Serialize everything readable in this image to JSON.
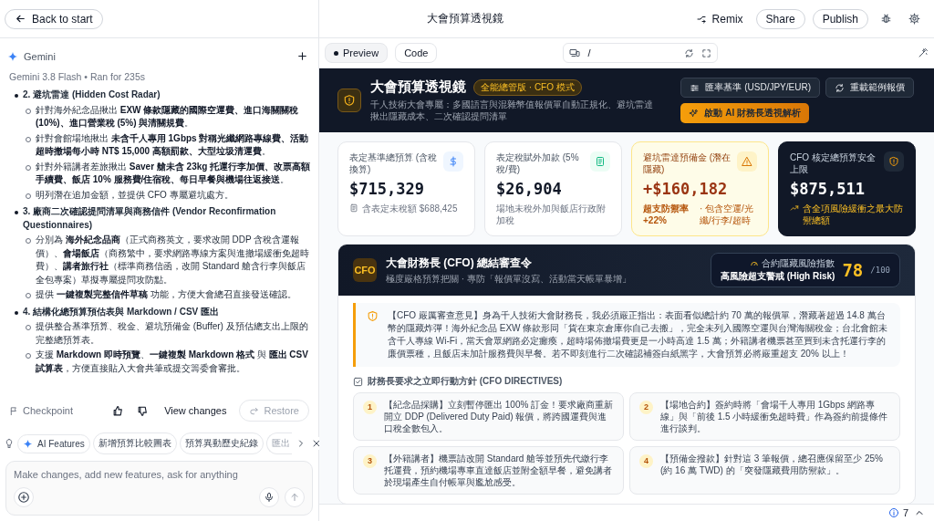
{
  "top_bar": {
    "back_button": "Back to start",
    "title": "大會預算透視鏡",
    "actions": [
      "Remix",
      "Share",
      "Publish"
    ]
  },
  "chat": {
    "assistant": "Gemini",
    "model": "Gemini 3.8 Flash",
    "separator": "•",
    "run_time": "Ran for 235s",
    "items": [
      {
        "text": "2. 避坑雷達 (Hidden Cost Radar)",
        "children": [
          {
            "text": "針對海外紀念品揪出 **EXW 條款隱藏的國際空運費、進口海關關稅 (10%)、進口營業稅 (5%) 與清關規費**。"
          },
          {
            "text": "針對會館場地揪出 **未含千人專用 1Gbps 對稱光纖網路專線費、活動超時撤場每小時 NT$ 15,000 高額罰款、大型垃圾清運費**。"
          },
          {
            "text": "針對外籍講者差旅揪出 **Saver 艙未含 23kg 托運行李加價、改票高額手續費、飯店 10% 服務費/住宿稅、每日早餐與機場往返接送**。"
          },
          {
            "text": "明列潛在追加金額，並提供 CFO 專屬避坑處方。"
          }
        ]
      },
      {
        "text": "3. 廠商二次確認提問清單與商務信件 (Vendor Reconfirmation Questionnaires)",
        "children": [
          {
            "text": "分別為 **海外紀念品商**（正式商務英文，要求改開 DDP 含稅含運報價）、**會場飯店**（商務繁中，要求網路專線方案與進撤場緩衝免超時費）、**講者旅行社**（標準商務信函，改開 Standard 艙含行李與飯店全包專案）草擬專屬提問攻防點。"
          },
          {
            "text": "提供 **一鍵複製完整信件草稿** 功能，方便大會總召直接發送確認。"
          }
        ]
      },
      {
        "text": "4. 結構化總預算預估表與 Markdown / CSV 匯出",
        "children": [
          {
            "text": "提供整合基準預算、稅金、避坑預備金 (Buffer) 及預估總支出上限的完整總預算表。"
          },
          {
            "text": "支援 **Markdown 即時預覽**、**一鍵複製 Markdown 格式** 與 **匯出 CSV 試算表**，方便直接貼入大會共筆或提交籌委會審批。"
          }
        ]
      }
    ],
    "checkpoint": "Checkpoint",
    "view_changes": "View changes",
    "restore": "Restore",
    "chips": [
      "AI Features",
      "新增預算比較圖表",
      "預算異動歷史紀錄",
      "匯出"
    ],
    "input": {
      "placeholder": "Make changes, add new features, ask for anything"
    }
  },
  "preview_toolbar": {
    "tabs": [
      {
        "label": "Preview",
        "selected": true
      },
      {
        "label": "Code",
        "selected": false
      }
    ],
    "url": "/"
  },
  "app": {
    "title": "大會預算透視鏡",
    "badge": "全能總管版 · CFO 模式",
    "subtitle": "千人技術大會專屬：多國語言與混雜幣值報價單自動正規化、避坑雷達揪出隱藏成本、二次確認提問清單",
    "buttons": [
      {
        "label": "匯率基準 (USD/JPY/EUR)",
        "kind": "secondary"
      },
      {
        "label": "重載範例報價",
        "kind": "secondary"
      },
      {
        "label": "啟動 AI 財務長透視解析",
        "kind": "primary"
      }
    ],
    "cards": [
      {
        "kind": "info",
        "label": "表定基準總預算 (含稅換算)",
        "value": "$715,329",
        "notes": [
          "含表定未稅額 $688,425"
        ]
      },
      {
        "kind": "tax",
        "label": "表定稅賦外加款 (5%稅/費)",
        "value": "$26,904",
        "notes": [
          "場地未稅外加與飯店行政附加稅"
        ]
      },
      {
        "kind": "warning",
        "label": "避坑雷達預備金 (潛在隱藏)",
        "value": "+$160,182",
        "notes": [
          "超支防禦率 +22%",
          "· 包含空運/光纖/行李/超時"
        ]
      },
      {
        "kind": "total",
        "label": "CFO 核定總預算安全上限",
        "value": "$875,511",
        "notes": [
          "含全項風險緩衝之最大防禦總額"
        ]
      }
    ],
    "cfo": {
      "badge": "CFO",
      "title": "大會財務長 (CFO) 總結審查令",
      "subtitle": "極度嚴格預算把關 · 專防「報價單沒寫、活動當天帳單暴增」",
      "risk_label": "合約隱藏風險指數",
      "risk_level": "高風險超支警戒 (High Risk)",
      "score": "78",
      "score_max": "/100",
      "opinion": "【CFO 嚴厲審查意見】身為千人技術大會財務長，我必須嚴正指出：表面看似總計約 70 萬的報價單，潛藏著超過 14.8 萬台幣的隱藏炸彈！海外紀念品 EXW 條款形同「貨在東京倉庫你自己去搬」，完全未列入國際空運與台灣海關稅金；台北會館未含千人專線 Wi-Fi，當天會眾網路必定癱瘓，超時場佈撤場費更是一小時高達 1.5 萬；外籍講者機票甚至買到未含托運行李的廉價票種，且飯店未加計服務費與早餐。若不即刻進行二次確認補簽白紙黑字，大會預算必將嚴重超支 20% 以上！",
      "directives_title": "財務長要求之立即行動方針 (CFO DIRECTIVES)",
      "directives": [
        {
          "number": "1",
          "text": "【紀念品採購】立刻暫停匯出 100% 訂金！要求廠商重新開立 DDP (Delivered Duty Paid) 報價，將跨國運費與進口稅全數包入。"
        },
        {
          "number": "2",
          "text": "【場地合約】簽約時將「會場千人專用 1Gbps 網路專線」與「前後 1.5 小時緩衝免超時費」作為簽約前提條件進行談判。"
        },
        {
          "number": "3",
          "text": "【外籍講者】機票請改開 Standard 艙等並預先代繳行李托運費，預約機場專車直達飯店並附全額早餐，避免講者於現場產生自付帳單與尷尬感受。"
        },
        {
          "number": "4",
          "text": "【預備金撥款】針對這 3 筆報價，總召應保留至少 25% (約 16 萬 TWD) 的「突發隱藏費用防禦款」。"
        }
      ]
    }
  },
  "status_bar": {
    "issues": "7"
  }
}
